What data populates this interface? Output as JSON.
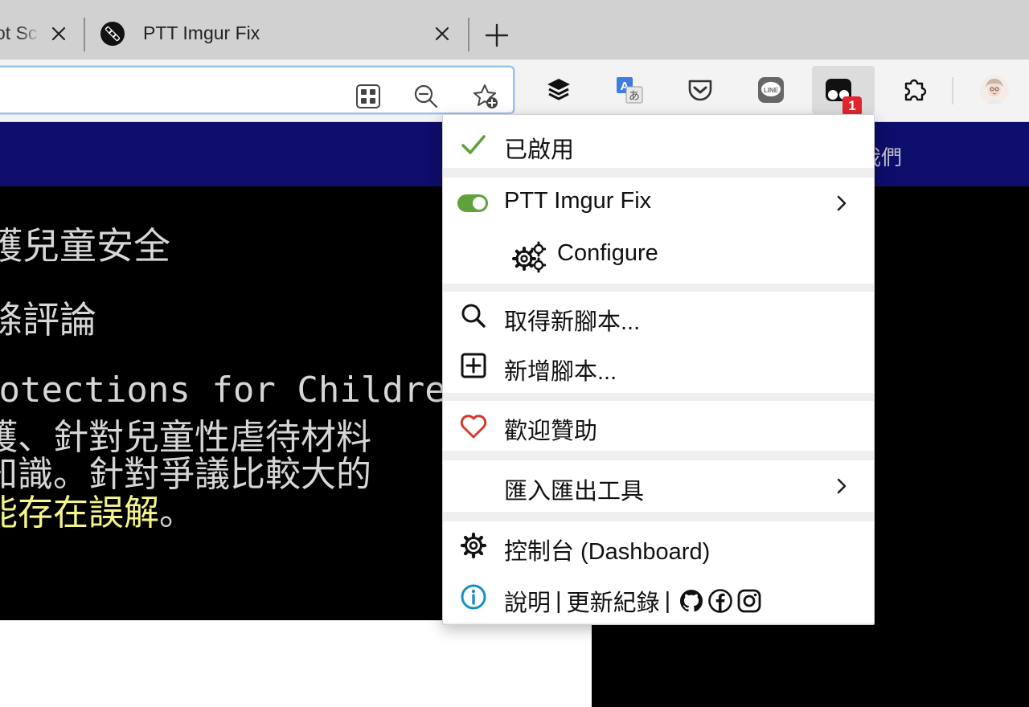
{
  "tabs": [
    {
      "title": "ot Sc",
      "close_icon": "close-icon"
    },
    {
      "title": "PTT Imgur Fix",
      "favicon": "ptt-imgur-fix-favicon",
      "close_icon": "close-icon"
    }
  ],
  "new_tab_icon": "plus-icon",
  "urlbar": {
    "icons": [
      "app-grid-icon",
      "zoom-out-icon",
      "add-favorite-icon"
    ]
  },
  "toolbar": {
    "extensions": [
      "layers-icon",
      "translate-icon",
      "pocket-icon",
      "line-icon",
      "tampermonkey-icon",
      "extensions-puzzle-icon",
      "profile-avatar"
    ],
    "badge_count": "1"
  },
  "page": {
    "nav_text": "我們",
    "lines": [
      "護兒童安全",
      "條評論",
      "rotections for Children",
      "護、針對兒童性虐待材料",
      "知識。針對爭議比較大的"
    ],
    "line6_highlight": "能存在誤解",
    "line6_rest": "。"
  },
  "menu": {
    "enabled_label": "已啟用",
    "script_name": "PTT Imgur Fix",
    "configure_label": "Configure",
    "get_scripts_label": "取得新腳本...",
    "new_script_label": "新增腳本...",
    "donate_label": "歡迎贊助",
    "import_export_label": "匯入匯出工具",
    "dashboard_label": "控制台 (Dashboard)",
    "help_label": "說明",
    "changelog_label": "更新紀錄",
    "separator": "|"
  },
  "colors": {
    "accent_green": "#5fa13a",
    "heart_red": "#d63a2f",
    "info_blue": "#1a8fc2",
    "badge_red": "#e0262c",
    "nav_blue": "#0d0d6b",
    "highlight_yellow": "#f5f58c"
  }
}
